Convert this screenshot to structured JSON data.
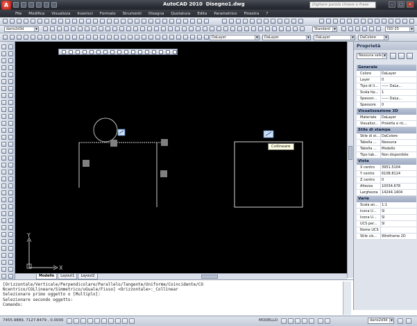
{
  "titlebar": {
    "app_name": "AutoCAD 2010",
    "file_name": "Disegno1.dwg",
    "search_placeholder": "Digitare parola chiave o frase",
    "app_letter": "A"
  },
  "menu": [
    "File",
    "Modifica",
    "Visualizza",
    "Inserisci",
    "Formato",
    "Strumenti",
    "Disegna",
    "Quotatura",
    "Edita",
    "Parametrico",
    "Finestra",
    "?"
  ],
  "toolbars": {
    "workspace": "dario2d3d",
    "text_style": "Standard",
    "dim_style": "ISO-25",
    "layer_color": "DaLayer",
    "layer_linetype": "DaLayer",
    "layer_lineweight": "DaLayer",
    "plot_style": "DaColore"
  },
  "layout_tabs": [
    "Modello",
    "Layout1",
    "Layout2"
  ],
  "ucs": {
    "x_label": "X",
    "y_label": "Y"
  },
  "canvas_tooltip": "Collineare",
  "properties": {
    "title": "Proprietà",
    "selection": "Nessuna sele",
    "sections": {
      "generale": "Generale",
      "vis3d": "Visualizzazione 3D",
      "stile": "Stile di stampa",
      "vista": "Vista",
      "varie": "Varie"
    },
    "generale_rows": [
      {
        "k": "Colore",
        "v": "DaLayer"
      },
      {
        "k": "Layer",
        "v": "0"
      },
      {
        "k": "Tipo di li...",
        "v": "—— DaLa..."
      },
      {
        "k": "Scala tip...",
        "v": "1"
      },
      {
        "k": "Spessor...",
        "v": "—— DaLa..."
      },
      {
        "k": "Spessore",
        "v": "0"
      }
    ],
    "vis3d_rows": [
      {
        "k": "Materiale",
        "v": "DaLayer"
      },
      {
        "k": "Visualizz...",
        "v": "Proietta e ric..."
      }
    ],
    "stile_rows": [
      {
        "k": "Stile di st...",
        "v": "DaColore"
      },
      {
        "k": "Tabella ...",
        "v": "Nessuna"
      },
      {
        "k": "Tabella ...",
        "v": "Modello"
      },
      {
        "k": "Tipo tab...",
        "v": "Non disponibile"
      }
    ],
    "vista_rows": [
      {
        "k": "X centro",
        "v": "3951.5104"
      },
      {
        "k": "Y centro",
        "v": "6108.8114"
      },
      {
        "k": "Z centro",
        "v": "0"
      },
      {
        "k": "Altezza",
        "v": "10034.678"
      },
      {
        "k": "Larghezza",
        "v": "14244.1404"
      }
    ],
    "varie_rows": [
      {
        "k": "Scala an...",
        "v": "1:1"
      },
      {
        "k": "Icona U...",
        "v": "Sì"
      },
      {
        "k": "Icona U...",
        "v": "Sì"
      },
      {
        "k": "UCS per...",
        "v": "Sì"
      },
      {
        "k": "Nome UCS",
        "v": ""
      },
      {
        "k": "Stile vis...",
        "v": "Wireframe 2D"
      }
    ]
  },
  "command": {
    "lines": [
      "[Orizzontale/Verticale/Perpendicolare/Parallelo/Tangente/Uniforme/Coincidente/CO",
      "Ncentrico/COLlineare/Simmetrico/uGuale/Fisso] <Orizzontale>:_Collinear",
      "Selezionare primo oggetto o [Multiplo]:",
      "Selezionare secondo oggetto:"
    ],
    "prompt": "Comando:"
  },
  "status": {
    "coords": "7455.9889, 7127.8479 , 0.0000",
    "model": "MODELLO",
    "workspace": "dario2d3d"
  }
}
